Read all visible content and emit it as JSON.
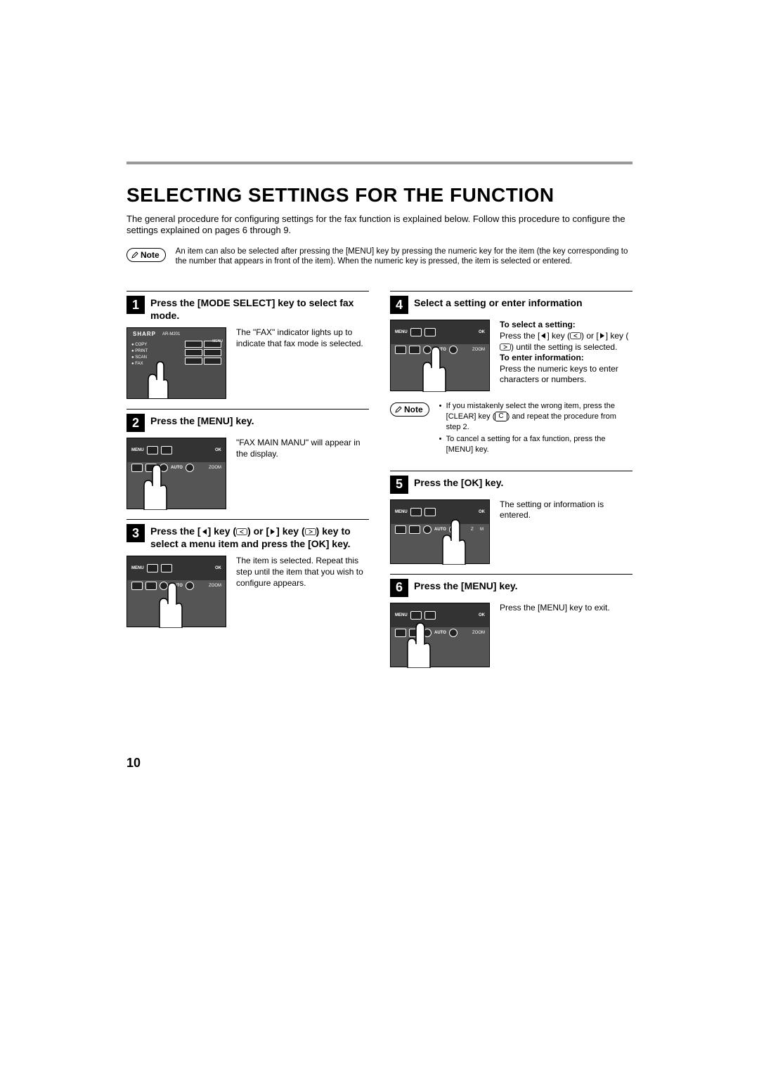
{
  "page_number": "10",
  "title": "SELECTING SETTINGS FOR THE FUNCTION",
  "intro": "The general procedure for configuring settings for the fax function is explained below. Follow this procedure to configure the settings explained on pages 6 through 9.",
  "top_note_label": "Note",
  "top_note_text": "An item can also be selected after pressing the [MENU] key by pressing the numeric key for the item (the key corresponding to the number that appears in front of the item). When the numeric key is pressed, the item is selected or entered.",
  "steps": {
    "s1": {
      "num": "1",
      "title": "Press the [MODE SELECT] key to select fax mode.",
      "body": "The \"FAX\" indicator lights up to indicate that fax mode is selected."
    },
    "s2": {
      "num": "2",
      "title": "Press the [MENU] key.",
      "body": "\"FAX MAIN MANU\" will appear in the display."
    },
    "s3": {
      "num": "3",
      "title_pre": "Press the [",
      "title_mid1": "] key (",
      "title_mid2": ") or [",
      "title_mid3": "] key (",
      "title_post": ") key to select a menu item and press the [OK] key.",
      "body": "The item is selected. Repeat this step until the item that you wish to configure appears."
    },
    "s4": {
      "num": "4",
      "title": "Select a setting or enter information",
      "sub1": "To select a setting:",
      "body1a": "Press the [",
      "body1b": "] key (",
      "body1c": ") or [",
      "body1d": "] key (",
      "body1e": ") until the setting is selected.",
      "sub2": "To enter information:",
      "body2": "Press the numeric keys to enter characters or numbers."
    },
    "s5": {
      "num": "5",
      "title": "Press the [OK] key.",
      "body": "The setting or information is entered."
    },
    "s6": {
      "num": "6",
      "title": "Press the [MENU] key.",
      "body": "Press the [MENU] key to exit."
    }
  },
  "mid_note_label": "Note",
  "mid_note_b1a": "If you mistakenly select the wrong item, press the [CLEAR] key (",
  "mid_note_b1_key": "C",
  "mid_note_b1b": ") and repeat the procedure from step 2.",
  "mid_note_b2": "To cancel a setting for a fax function, press the [MENU] key.",
  "panel": {
    "brand": "SHARP",
    "model": "AR-M201",
    "modes": [
      "COPY",
      "PRINT",
      "SCAN",
      "FAX"
    ],
    "menu": "MENU",
    "ok": "OK",
    "auto": "AUTO",
    "zoom": "ZOOM"
  }
}
